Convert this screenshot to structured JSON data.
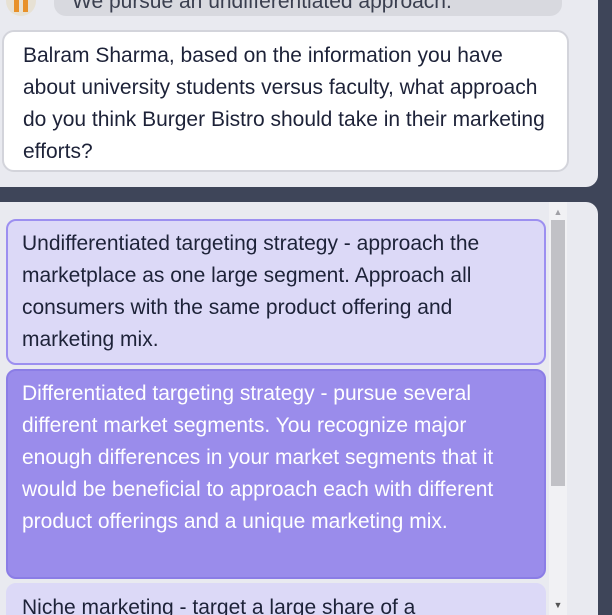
{
  "previous_message": {
    "text": "We pursue an undifferentiated approach."
  },
  "question": {
    "text": "Balram Sharma, based on the information you have about university students versus faculty, what approach do you think Burger Bistro should take in their marketing efforts?"
  },
  "options": [
    {
      "text": "Undifferentiated targeting strategy - approach the marketplace as one large segment. Approach all consumers with the same product offering and marketing mix."
    },
    {
      "text": "Differentiated targeting strategy - pursue several different market segments. You recognize major enough differences in your market segments that it would be beneficial to approach each with different product offerings and a unique marketing mix."
    },
    {
      "text": "Niche marketing - target a large share of a"
    }
  ],
  "scrollbar": {
    "up_icon": "▲",
    "down_icon": "▼"
  },
  "colors": {
    "background": "#3e4559",
    "panel": "#e9eaf0",
    "option": "#dcd9f7",
    "option_selected": "#9a8ceb"
  }
}
